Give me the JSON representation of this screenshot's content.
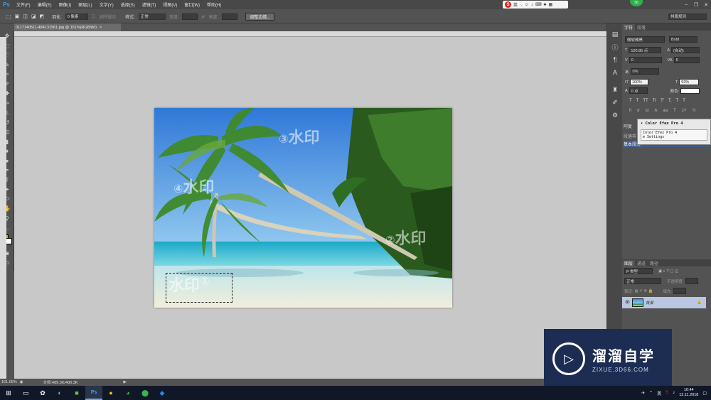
{
  "app": {
    "logo": "Ps"
  },
  "menu": [
    "文件(F)",
    "编辑(E)",
    "图像(I)",
    "图层(L)",
    "文字(Y)",
    "选择(S)",
    "滤镜(T)",
    "视图(V)",
    "窗口(W)",
    "帮助(H)"
  ],
  "ime": {
    "label": "英"
  },
  "user_badge": "56",
  "options": {
    "feather_label": "羽化:",
    "feather_value": "0 像素",
    "antialias_label": "消除锯齿",
    "style_label": "样式:",
    "style_value": "正常",
    "width_label": "宽度:",
    "height_label": "高度:",
    "refine_button": "调整边缘...",
    "workspace_select": "排版规则"
  },
  "document": {
    "tab_title": "0117140511-484131561.jpg @ 161%(RGB/8#)",
    "zoom": "161.05%",
    "doc_info": "文档:489.3K/489.3K"
  },
  "watermarks": [
    {
      "num": "①",
      "text": "水印"
    },
    {
      "num": "②",
      "text": "水印"
    },
    {
      "num": "③",
      "text": "水印"
    },
    {
      "num": "④",
      "text": "水印"
    }
  ],
  "character_panel": {
    "tabs": [
      "字符",
      "段落"
    ],
    "font_family": "微软雅黑",
    "font_style": "Bold",
    "font_size": "120.85 点",
    "leading": "(自动)",
    "kerning": "0",
    "tracking": "5",
    "scale_pct": "0%",
    "vertical_scale": "100%",
    "horizontal_scale": "93%",
    "baseline": "0 点",
    "color_label": "颜色:",
    "type_buttons": [
      "T",
      "T",
      "TT",
      "Tr",
      "T'",
      "T,",
      "T",
      "T"
    ]
  },
  "efex": {
    "title": "Color Efex Pro 4",
    "inner": "Color Efex Pro 4",
    "settings": "Settings",
    "under_labels": [
      "阿复",
      "段落样",
      "基本段落"
    ]
  },
  "layers_panel": {
    "tabs": [
      "图层",
      "通道",
      "路径"
    ],
    "filter_label": "P 类型",
    "blend_mode": "正常",
    "opacity_label": "不透明度:",
    "lock_label": "锁定:",
    "fill_label": "填充:",
    "layer_name": "背景"
  },
  "brand": {
    "name": "溜溜自学",
    "url": "ZIXUE.3D66.COM"
  },
  "taskbar": {
    "lang": "英",
    "time": "10:44",
    "date": "12.11.2018"
  }
}
